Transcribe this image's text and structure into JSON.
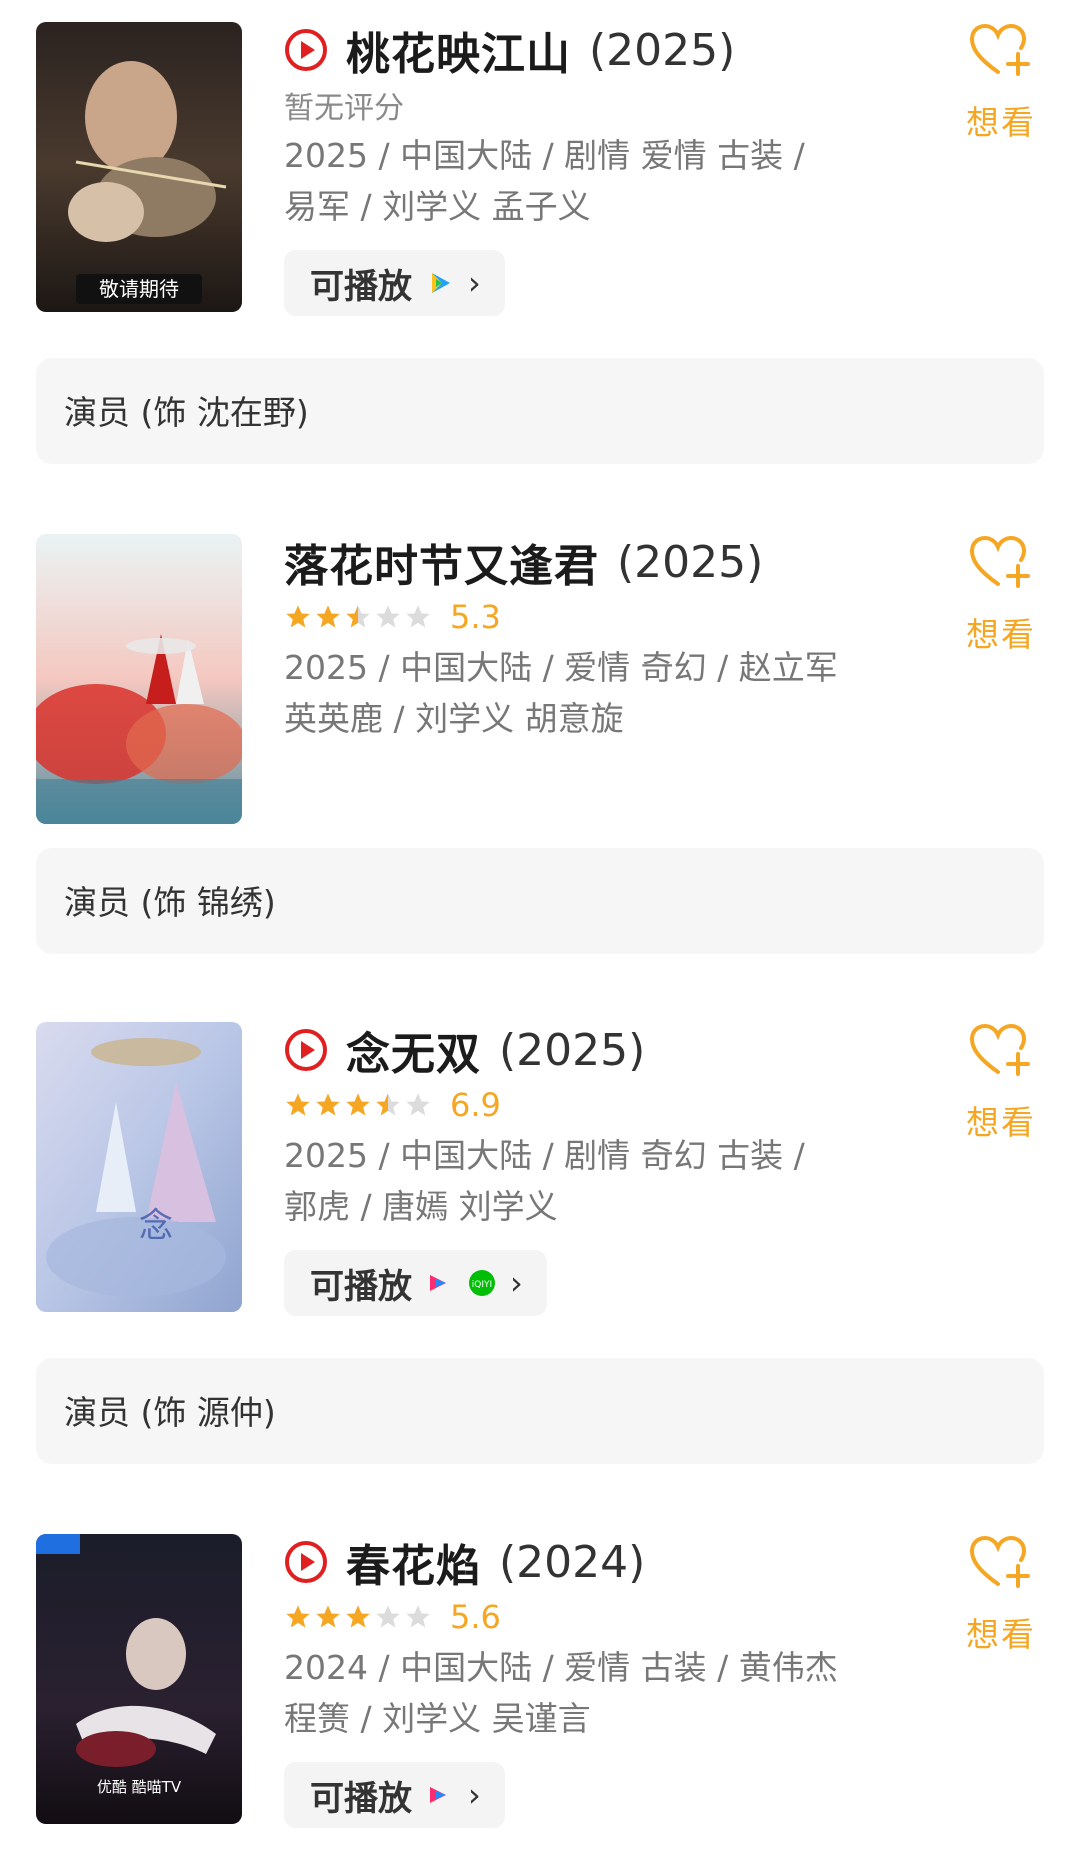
{
  "items": [
    {
      "title": "桃花映江山",
      "year": "(2025)",
      "has_play_icon": true,
      "rating": {
        "text": "暂无评分",
        "score": null,
        "stars": null
      },
      "meta_line1": "2025 / 中国大陆 / 剧情 爱情 古装 /",
      "meta_line2": "易军 / 刘学义 孟子义",
      "play_label": "可播放",
      "platforms": [
        "tencent-video-icon"
      ],
      "want_label": "想看",
      "role": "演员 (饰 沈在野)",
      "poster_text": "敬请期待"
    },
    {
      "title": "落花时节又逢君",
      "year": "(2025)",
      "has_play_icon": false,
      "rating": {
        "text": null,
        "score": "5.3",
        "stars": 2.5
      },
      "meta_line1": "2025 / 中国大陆 / 爱情 奇幻 / 赵立军",
      "meta_line2": "英英鹿 / 刘学义 胡意旋",
      "play_label": null,
      "platforms": [],
      "want_label": "想看",
      "role": "演员 (饰 锦绣)"
    },
    {
      "title": "念无双",
      "year": "(2025)",
      "has_play_icon": true,
      "rating": {
        "text": null,
        "score": "6.9",
        "stars": 3.5
      },
      "meta_line1": "2025 / 中国大陆 / 剧情 奇幻 古装 /",
      "meta_line2": "郭虎 / 唐嫣 刘学义",
      "play_label": "可播放",
      "platforms": [
        "youku-icon",
        "iqiyi-icon"
      ],
      "want_label": "想看",
      "role": "演员 (饰 源仲)"
    },
    {
      "title": "春花焰",
      "year": "(2024)",
      "has_play_icon": true,
      "rating": {
        "text": null,
        "score": "5.6",
        "stars": 3
      },
      "meta_line1": "2024 / 中国大陆 / 爱情 古装 / 黄伟杰",
      "meta_line2": "程箦 / 刘学义 吴谨言",
      "play_label": "可播放",
      "platforms": [
        "youku-icon"
      ],
      "want_label": "想看",
      "role": null,
      "poster_text": "优酷 酷喵TV"
    }
  ],
  "colors": {
    "accent": "#f5a623",
    "play_red": "#e02020",
    "star_gray": "#dcdcdc"
  }
}
